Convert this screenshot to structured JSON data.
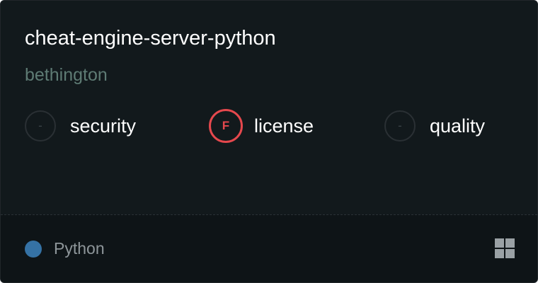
{
  "repo": {
    "name": "cheat-engine-server-python",
    "owner": "bethington"
  },
  "metrics": [
    {
      "label": "security",
      "grade": "-"
    },
    {
      "label": "license",
      "grade": "F"
    },
    {
      "label": "quality",
      "grade": "-"
    }
  ],
  "footer": {
    "language": "Python",
    "language_color": "#3572a5",
    "platform_icon": "windows-icon"
  },
  "colors": {
    "fail": "#e5484d",
    "background": "#12191c",
    "footer_background": "#0e1417"
  }
}
